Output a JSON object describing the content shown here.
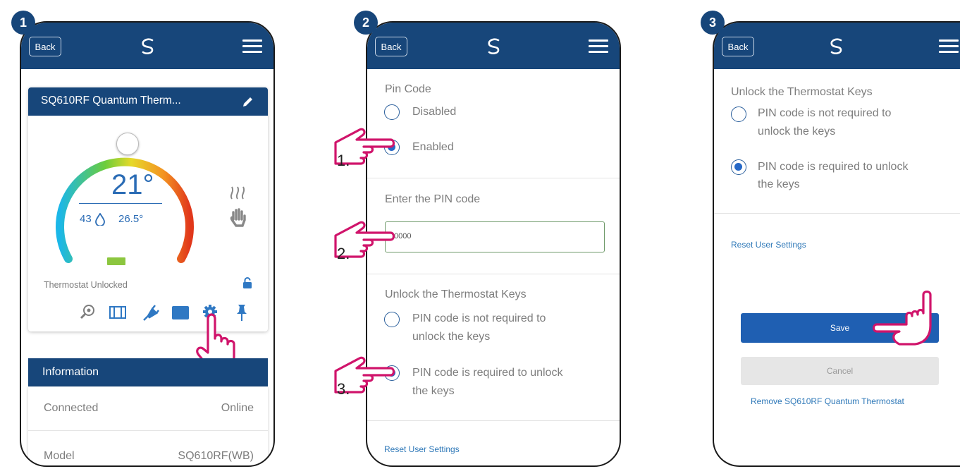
{
  "common": {
    "back_label": "Back"
  },
  "panel1": {
    "step": "1",
    "device_title": "SQ610RF Quantum Therm...",
    "setpoint": "21°",
    "humidity": "43",
    "current_temp": "26.5°",
    "status_text": "Thermostat Unlocked",
    "info_header": "Information",
    "rows": [
      {
        "label": "Connected",
        "value": "Online"
      },
      {
        "label": "Model",
        "value": "SQ610RF(WB)"
      }
    ]
  },
  "panel2": {
    "step": "2",
    "pin_code_label": "Pin Code",
    "option_disabled": "Disabled",
    "option_enabled": "Enabled",
    "enter_pin_label": "Enter the PIN code",
    "pin_value": "0000",
    "unlock_label": "Unlock the Thermostat Keys",
    "opt_not_required_1": "PIN code is not required to",
    "opt_not_required_2": "unlock the keys",
    "opt_required_1": "PIN code is required to unlock",
    "opt_required_2": "the keys",
    "reset_link": "Reset User Settings",
    "callouts": [
      "1.",
      "2.",
      "3."
    ]
  },
  "panel3": {
    "step": "3",
    "unlock_label": "Unlock the Thermostat Keys",
    "opt_not_required_1": "PIN code is not required to",
    "opt_not_required_2": "unlock the keys",
    "opt_required_1": "PIN code is required to unlock",
    "opt_required_2": "the keys",
    "reset_link": "Reset User Settings",
    "save_label": "Save",
    "cancel_label": "Cancel",
    "remove_link": "Remove SQ610RF Quantum Thermostat"
  },
  "colors": {
    "header": "#17467a",
    "accent": "#2668c7",
    "hand": "#d0146b"
  }
}
